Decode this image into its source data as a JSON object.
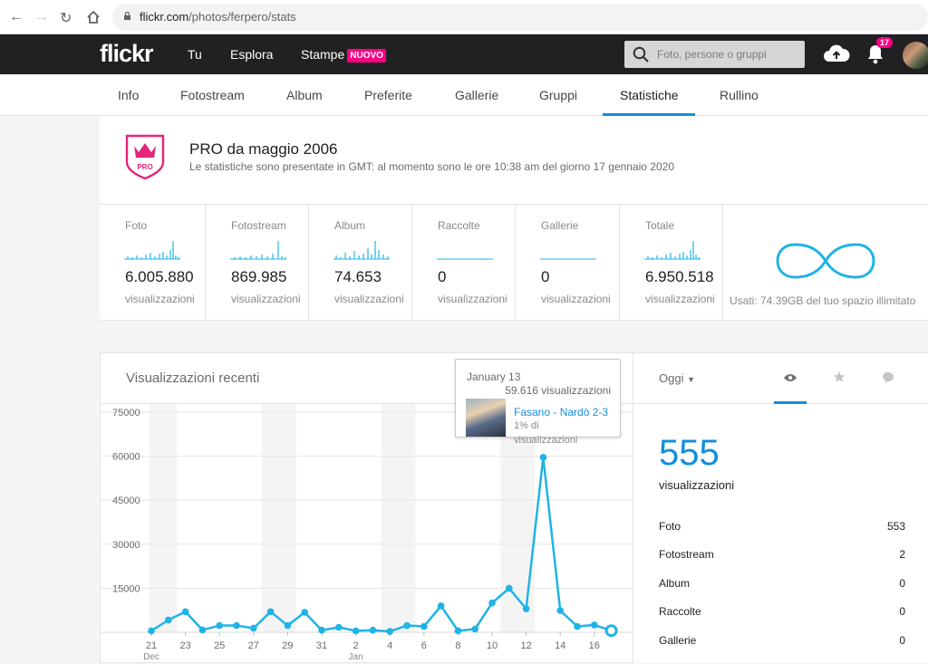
{
  "browser": {
    "url_host": "flickr.com",
    "url_path": "/photos/ferpero/stats"
  },
  "header": {
    "logo": "flickr",
    "nav": [
      "Tu",
      "Esplora",
      "Stampe"
    ],
    "new_badge": "NUOVO",
    "search_placeholder": "Foto, persone o gruppi",
    "notification_count": "17"
  },
  "subnav": {
    "tabs": [
      "Info",
      "Fotostream",
      "Album",
      "Preferite",
      "Gallerie",
      "Gruppi",
      "Statistiche",
      "Rullino"
    ],
    "active": "Statistiche"
  },
  "pro": {
    "badge": "PRO",
    "title": "PRO da maggio 2006",
    "subtitle": "Le statistiche sono presentate in GMT: al momento sono le ore 10:38 am del giorno 17 gennaio 2020"
  },
  "stats": [
    {
      "label": "Foto",
      "value": "6.005.880",
      "unit": "visualizzazioni"
    },
    {
      "label": "Fotostream",
      "value": "869.985",
      "unit": "visualizzazioni"
    },
    {
      "label": "Album",
      "value": "74.653",
      "unit": "visualizzazioni"
    },
    {
      "label": "Raccolte",
      "value": "0",
      "unit": "visualizzazioni"
    },
    {
      "label": "Gallerie",
      "value": "0",
      "unit": "visualizzazioni"
    },
    {
      "label": "Totale",
      "value": "6.950.518",
      "unit": "visualizzazioni"
    }
  ],
  "usage": "Usati: 74.39GB del tuo spazio illimitato",
  "chart_panel": {
    "title": "Visualizzazioni recenti"
  },
  "chart_data": {
    "type": "line",
    "title": "Visualizzazioni recenti",
    "ylim": [
      0,
      75000
    ],
    "y_ticks": [
      "75000",
      "60000",
      "45000",
      "30000",
      "15000"
    ],
    "x_tick_labels": [
      "21",
      "23",
      "25",
      "27",
      "29",
      "31",
      "2",
      "4",
      "6",
      "8",
      "10",
      "12",
      "14",
      "16"
    ],
    "x_month_labels": [
      {
        "at": "21",
        "label": "Dec"
      },
      {
        "at": "2",
        "label": "Jan"
      }
    ],
    "x": [
      "Dec 21",
      "Dec 22",
      "Dec 23",
      "Dec 24",
      "Dec 25",
      "Dec 26",
      "Dec 27",
      "Dec 28",
      "Dec 29",
      "Dec 30",
      "Dec 31",
      "Jan 1",
      "Jan 2",
      "Jan 3",
      "Jan 4",
      "Jan 5",
      "Jan 6",
      "Jan 7",
      "Jan 8",
      "Jan 9",
      "Jan 10",
      "Jan 11",
      "Jan 12",
      "Jan 13",
      "Jan 14",
      "Jan 15",
      "Jan 16",
      "Jan 17"
    ],
    "series": [
      {
        "values": [
          500,
          4200,
          7000,
          800,
          2300,
          2300,
          1400,
          7000,
          2300,
          6800,
          700,
          1700,
          500,
          700,
          300,
          2300,
          2000,
          9000,
          500,
          1100,
          10000,
          15000,
          8000,
          59616,
          7400,
          2000,
          2500,
          555
        ]
      }
    ],
    "highlighted_date": "Jan 13"
  },
  "tooltip": {
    "date": "January 13",
    "views": "59.616 visualizzazioni",
    "photo_title": "Fasano - Nardò 2-3",
    "percent": "1% di",
    "percent_unit": "visualizzazioni"
  },
  "right_panel": {
    "period": "Oggi",
    "big_number": "555",
    "big_label": "visualizzazioni",
    "breakdown": [
      {
        "label": "Foto",
        "value": "553"
      },
      {
        "label": "Fotostream",
        "value": "2"
      },
      {
        "label": "Album",
        "value": "0"
      },
      {
        "label": "Raccolte",
        "value": "0"
      },
      {
        "label": "Gallerie",
        "value": "0"
      }
    ]
  },
  "colors": {
    "accent": "#128fdc",
    "chart_line": "#1fb3e6",
    "pink": "#ff0084",
    "pro_pink": "#e5247a"
  }
}
